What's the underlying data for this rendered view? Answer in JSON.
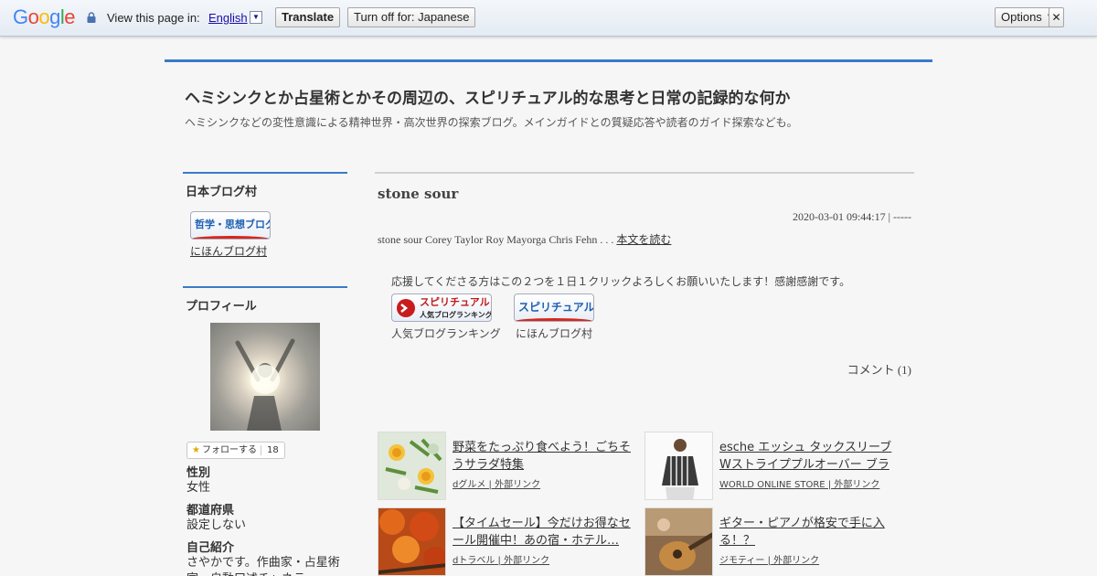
{
  "translate_bar": {
    "logo": [
      "G",
      "o",
      "o",
      "g",
      "l",
      "e"
    ],
    "logo_colors": [
      "#4285f4",
      "#ea4335",
      "#fbbc05",
      "#4285f4",
      "#34a853",
      "#ea4335"
    ],
    "view_label": "View this page in:",
    "language": "English",
    "translate_label": "Translate",
    "turn_off_label": "Turn off for: Japanese",
    "options_label": "Options ▼",
    "close_label": "✕"
  },
  "blog": {
    "title": "ヘミシンクとか占星術とかその周辺の、スピリチュアル的な思考と日常の記録的な何か",
    "description": "ヘミシンクなどの変性意識による精神世界・高次世界の探索ブログ。メインガイドとの質疑応答や読者のガイド探索なども。"
  },
  "sidebar": {
    "village_heading": "日本ブログ村",
    "village_banner": "哲学・思想ブログ",
    "village_link": "にほんブログ村",
    "profile_heading": "プロフィール",
    "follow_label": "フォローする",
    "follow_count": "18",
    "profile_fields": [
      {
        "label": "性別",
        "value": "女性"
      },
      {
        "label": "都道府県",
        "value": "設定しない"
      },
      {
        "label": "自己紹介",
        "value": "さやかです。作曲家・占星術家・自動口述チャネラー"
      }
    ]
  },
  "post": {
    "title": "stone sour",
    "date": "2020-03-01 09:44:17 | -----",
    "excerpt": "stone sour Corey Taylor Roy Mayorga Chris Fehn . . . ",
    "read_more": "本文を読む",
    "support_message": "応援してくださる方はこの２つを１日１クリックよろしくお願いいたします！感謝感謝です。",
    "banner1_text": "スピリチュアル",
    "banner1_sub": "人気ブログランキング",
    "banner1_label": "人気ブログランキング",
    "banner2_text": "スピリチュアル",
    "banner2_label": "にほんブログ村",
    "comments": "コメント (1)"
  },
  "ads": [
    {
      "title": "野菜をたっぷり食べよう！ごちそうサラダ特集",
      "source": "dグルメ | 外部リンク"
    },
    {
      "title": "esche エッシュ タックスリーブWストライププルオーバー ブラック(…",
      "source": "WORLD ONLINE STORE | 外部リンク"
    },
    {
      "title": "【タイムセール】今だけお得なセール開催中！あの宿・ホテル…",
      "source": "dトラベル | 外部リンク"
    },
    {
      "title": "ギター・ピアノが格安で手に入る！？",
      "source": "ジモティー | 外部リンク"
    }
  ]
}
